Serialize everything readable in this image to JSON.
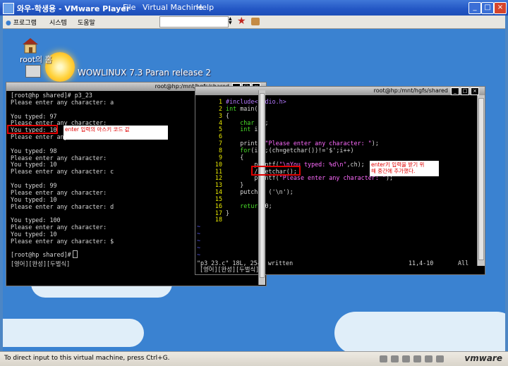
{
  "vmware": {
    "title": "와우-학생용 - VMware Player",
    "menu_file": "File",
    "menu_vm": "Virtual Machine",
    "menu_help": "Help",
    "btn_min": "_",
    "btn_max": "□",
    "btn_close": "×",
    "status_text": "To direct input to this virtual machine, press Ctrl+G.",
    "logo": "vmware"
  },
  "guest_taskbar": {
    "programs": "프로그램",
    "system": "시스템",
    "help": "도움말"
  },
  "desktop": {
    "icon_label": "root의 홈",
    "release": "WOWLINUX 7.3 Paran release 2"
  },
  "terminal_left": {
    "title": "root@hp:/mnt/hgfs/shared",
    "lines": [
      "[root@hp shared]# p3_23",
      "Please enter any character: a",
      "",
      "You typed: 97",
      "Please enter any character:",
      "You typed: 10",
      "Please enter any character:",
      "",
      "You typed: 98",
      "Please enter any character:",
      "You typed: 10",
      "Please enter any character: c",
      "",
      "You typed: 99",
      "Please enter any character:",
      "You typed: 10",
      "Please enter any character: d",
      "",
      "You typed: 100",
      "Please enter any character:",
      "You typed: 10",
      "Please enter any character: $",
      "",
      "[root@hp shared]# "
    ],
    "ime": "[영어][완성][두벌식]",
    "annotation": "enter 입력의 아스키 코드 값"
  },
  "terminal_right": {
    "title": "root@hp:/mnt/hgfs/shared",
    "code": [
      {
        "n": "1",
        "t": "#include<stdio.h>"
      },
      {
        "n": "2",
        "t": "int main()"
      },
      {
        "n": "3",
        "t": "{"
      },
      {
        "n": "4",
        "t": "    char ch;"
      },
      {
        "n": "5",
        "t": "    int i;"
      },
      {
        "n": "6",
        "t": ""
      },
      {
        "n": "7",
        "t": "    printf(\"Please enter any character: \");"
      },
      {
        "n": "8",
        "t": "    for(i=0;(ch=getchar())!='$';i++)"
      },
      {
        "n": "9",
        "t": "    {"
      },
      {
        "n": "10",
        "t": "        printf(\"\\nYou typed: %d\\n\",ch);"
      },
      {
        "n": "11",
        "t": "        //getchar();"
      },
      {
        "n": "12",
        "t": "        printf(\"Please enter any character: \");"
      },
      {
        "n": "13",
        "t": "    }"
      },
      {
        "n": "14",
        "t": "    putchar ('\\n');"
      },
      {
        "n": "15",
        "t": ""
      },
      {
        "n": "16",
        "t": "    return 0;"
      },
      {
        "n": "17",
        "t": "}"
      },
      {
        "n": "18",
        "t": ""
      }
    ],
    "tilde": "~",
    "status_file": "\"p3_23.c\" 18L, 254C written",
    "status_pos": "11,4-10",
    "status_all": "All",
    "ime": "[영어][완성][두벌식]",
    "annotation_line1": "enter키 입력을 받기 위",
    "annotation_line2": "해 중간에 추가했다."
  },
  "colors": {
    "title_blue": "#2356c4",
    "desktop_blue": "#3a82d1",
    "highlight_red": "#e00000",
    "vim_linenr": "#e8e800",
    "vim_keyword": "#4ade2a"
  }
}
